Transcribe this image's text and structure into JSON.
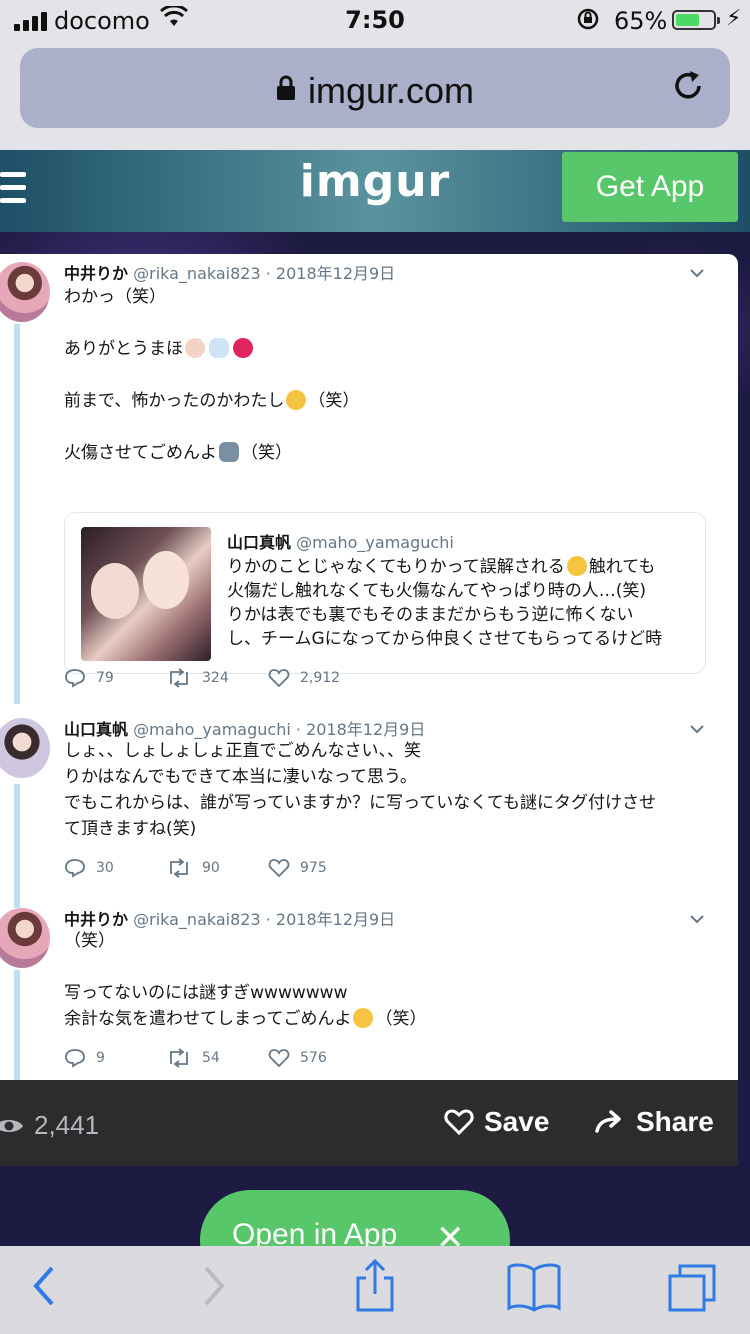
{
  "status_bar": {
    "carrier": "docomo",
    "time": "7:50",
    "battery_percent": "65%",
    "battery_level": 0.65
  },
  "browser": {
    "url": "imgur.com"
  },
  "imgur_header": {
    "logo": "imgur",
    "get_app_label": "Get App"
  },
  "tweets": [
    {
      "name": "中井りか",
      "handle": "@rika_nakai823",
      "date": "2018年12月9日",
      "lines": [
        "わかっ（笑）",
        "",
        "ありがとうまほ",
        "",
        "前まで、怖かったのかわたし",
        "",
        "火傷させてごめんよ"
      ],
      "line_suffix": [
        "（笑）",
        "（笑）"
      ],
      "replies": "79",
      "retweets": "324",
      "likes": "2,912"
    },
    {
      "name": "山口真帆",
      "handle": "@maho_yamaguchi",
      "date": "2018年12月9日",
      "text": "しょ、、しょしょしょ正直でごめんなさい、、笑\nりかはなんでもできて本当に凄いなって思う。\nでもこれからは、誰が写っていますか？に写っていなくても謎にタグ付けさせ\nて頂きますね(笑)",
      "replies": "30",
      "retweets": "90",
      "likes": "975"
    },
    {
      "name": "中井りか",
      "handle": "@rika_nakai823",
      "date": "2018年12月9日",
      "line1": "（笑）",
      "line2": "写ってないのには謎すぎwwwwwww",
      "line3": "余計な気を遣わせてしまってごめんよ",
      "line3_suffix": "（笑）",
      "replies": "9",
      "retweets": "54",
      "likes": "576"
    }
  ],
  "quoted_tweet": {
    "name": "山口真帆",
    "handle": "@maho_yamaguchi",
    "text_a": "りかのことじゃなくてもりかって誤解される",
    "text_b": "触れても\n火傷だし触れなくても火傷なんてやっぱり時の人…(笑)\nりかは表でも裏でもそのままだからもう逆に怖くない\nし、チームGになってから仲良くさせてもらってるけど時"
  },
  "post_footer": {
    "views": "2,441",
    "save_label": "Save",
    "share_label": "Share"
  },
  "open_in_app": {
    "label": "Open in App",
    "close_glyph": "✕"
  },
  "colors": {
    "imgur_green": "#57c76a",
    "thread_line": "#bde0f4",
    "footer_bg": "#2c2c2e"
  }
}
